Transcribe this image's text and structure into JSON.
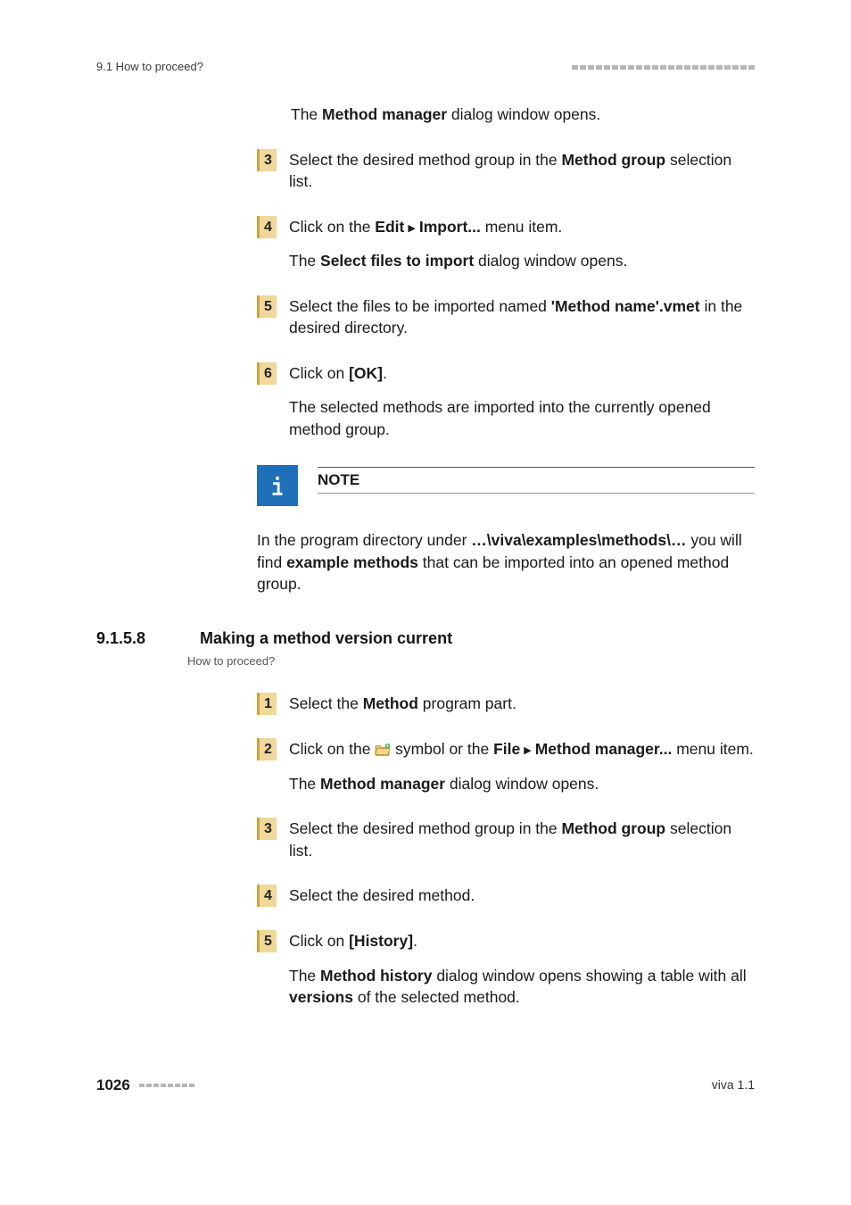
{
  "header": {
    "section_ref": "9.1 How to proceed?"
  },
  "intro_line": {
    "pre": "The ",
    "bold": "Method manager",
    "post": " dialog window opens."
  },
  "steps_a": [
    {
      "num": "3",
      "lines": [
        {
          "parts": [
            {
              "t": "Select the desired method group in the "
            },
            {
              "t": "Method group",
              "b": true
            },
            {
              "t": " selection list."
            }
          ]
        }
      ]
    },
    {
      "num": "4",
      "lines": [
        {
          "parts": [
            {
              "t": "Click on the "
            },
            {
              "t": "Edit",
              "b": true
            },
            {
              "sep": true
            },
            {
              "t": "Import...",
              "b": true
            },
            {
              "t": " menu item."
            }
          ]
        },
        {
          "parts": [
            {
              "t": "The "
            },
            {
              "t": "Select files to import",
              "b": true
            },
            {
              "t": " dialog window opens."
            }
          ]
        }
      ]
    },
    {
      "num": "5",
      "lines": [
        {
          "parts": [
            {
              "t": "Select the files to be imported named "
            },
            {
              "t": "'Method name'.vmet",
              "b": true
            },
            {
              "t": " in the desired directory."
            }
          ]
        }
      ]
    },
    {
      "num": "6",
      "lines": [
        {
          "parts": [
            {
              "t": "Click on "
            },
            {
              "t": "[OK]",
              "b": true
            },
            {
              "t": "."
            }
          ]
        },
        {
          "parts": [
            {
              "t": "The selected methods are imported into the currently opened method group."
            }
          ]
        }
      ]
    }
  ],
  "note": {
    "label": "NOTE",
    "body_parts": [
      {
        "t": "In the program directory under "
      },
      {
        "t": "…\\viva\\examples\\methods\\…",
        "b": true
      },
      {
        "t": " you will find "
      },
      {
        "t": "example methods",
        "b": true
      },
      {
        "t": " that can be imported into an opened method group."
      }
    ]
  },
  "section": {
    "num": "9.1.5.8",
    "title": "Making a method version current",
    "howto": "How to proceed?"
  },
  "steps_b": [
    {
      "num": "1",
      "lines": [
        {
          "parts": [
            {
              "t": "Select the "
            },
            {
              "t": "Method",
              "b": true
            },
            {
              "t": " program part."
            }
          ]
        }
      ]
    },
    {
      "num": "2",
      "lines": [
        {
          "parts": [
            {
              "t": "Click on the "
            },
            {
              "icon": "openfolder"
            },
            {
              "t": " symbol or the "
            },
            {
              "t": "File",
              "b": true
            },
            {
              "sep": true
            },
            {
              "t": "Method manager...",
              "b": true
            },
            {
              "t": " menu item."
            }
          ]
        },
        {
          "parts": [
            {
              "t": "The "
            },
            {
              "t": "Method manager",
              "b": true
            },
            {
              "t": " dialog window opens."
            }
          ]
        }
      ]
    },
    {
      "num": "3",
      "lines": [
        {
          "parts": [
            {
              "t": "Select the desired method group in the "
            },
            {
              "t": "Method group",
              "b": true
            },
            {
              "t": " selection list."
            }
          ]
        }
      ]
    },
    {
      "num": "4",
      "lines": [
        {
          "parts": [
            {
              "t": "Select the desired method."
            }
          ]
        }
      ]
    },
    {
      "num": "5",
      "lines": [
        {
          "parts": [
            {
              "t": "Click on "
            },
            {
              "t": "[History]",
              "b": true
            },
            {
              "t": "."
            }
          ]
        },
        {
          "parts": [
            {
              "t": "The "
            },
            {
              "t": "Method history",
              "b": true
            },
            {
              "t": " dialog window opens showing a table with all "
            },
            {
              "t": "versions",
              "b": true
            },
            {
              "t": " of the selected method."
            }
          ]
        }
      ]
    }
  ],
  "footer": {
    "page": "1026",
    "product": "viva 1.1"
  },
  "glyphs": {
    "menu_sep": "▶"
  }
}
